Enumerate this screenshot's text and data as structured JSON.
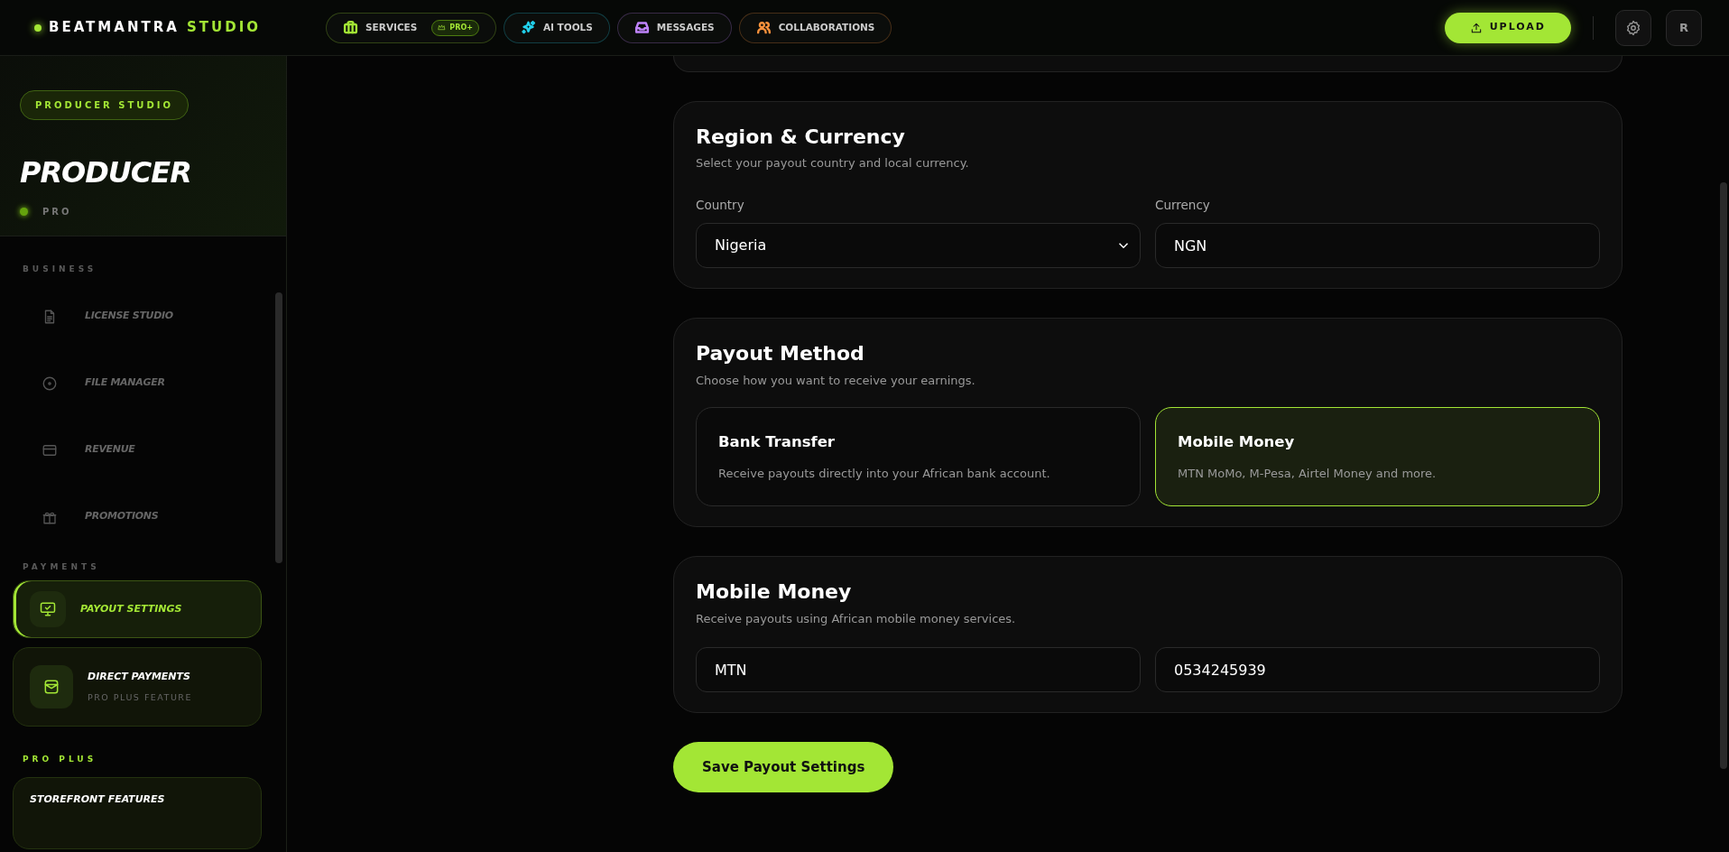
{
  "brand": {
    "name": "BEATMANTRA",
    "accent": "STUDIO"
  },
  "nav_tabs": [
    {
      "label": "SERVICES",
      "badge": "PRO+",
      "color": "#a3e635"
    },
    {
      "label": "AI TOOLS",
      "color": "#22d3ee"
    },
    {
      "label": "MESSAGES",
      "color": "#c084fc"
    },
    {
      "label": "COLLABORATIONS",
      "color": "#fb923c"
    }
  ],
  "upload_button": "UPLOAD",
  "avatar": "R",
  "sidebar": {
    "badge": "PRODUCER STUDIO",
    "title": "PRODUCER",
    "plan": "PRO",
    "sections": [
      {
        "heading": "BUSINESS",
        "kind": "muted",
        "items": [
          {
            "label": "LICENSE STUDIO",
            "kind": "link",
            "selected": false
          },
          {
            "label": "FILE MANAGER",
            "kind": "link",
            "selected": false
          },
          {
            "label": "REVENUE",
            "kind": "link",
            "selected": false
          },
          {
            "label": "PROMOTIONS",
            "kind": "link",
            "selected": false
          }
        ]
      },
      {
        "heading": "PAYMENTS",
        "kind": "muted",
        "items": [
          {
            "label": "PAYOUT SETTINGS",
            "kind": "tile",
            "selected": true
          },
          {
            "label": "DIRECT PAYMENTS",
            "sublabel": "PRO PLUS FEATURE",
            "kind": "tile",
            "selected": false
          }
        ]
      },
      {
        "heading": "PRO PLUS",
        "kind": "accent",
        "items": [
          {
            "label": "STOREFRONT FEATURES",
            "kind": "card",
            "selected": false
          }
        ]
      }
    ]
  },
  "region": {
    "title": "Region & Currency",
    "subtitle": "Select your payout country and local currency.",
    "fields": [
      {
        "label": "Country",
        "value": "Nigeria",
        "kind": "select"
      },
      {
        "label": "Currency",
        "value": "NGN",
        "kind": "text"
      }
    ]
  },
  "payout_method": {
    "title": "Payout Method",
    "subtitle": "Choose how you want to receive your earnings.",
    "options": [
      {
        "title": "Bank Transfer",
        "description": "Receive payouts directly into your African bank account.",
        "selected": false
      },
      {
        "title": "Mobile Money",
        "description": "MTN MoMo, M-Pesa, Airtel Money and more.",
        "selected": true
      }
    ]
  },
  "mobile_money": {
    "title": "Mobile Money",
    "subtitle": "Receive payouts using African mobile money services.",
    "fields": [
      {
        "value": "MTN"
      },
      {
        "value": "0534245939"
      }
    ]
  },
  "save_button": "Save Payout Settings"
}
